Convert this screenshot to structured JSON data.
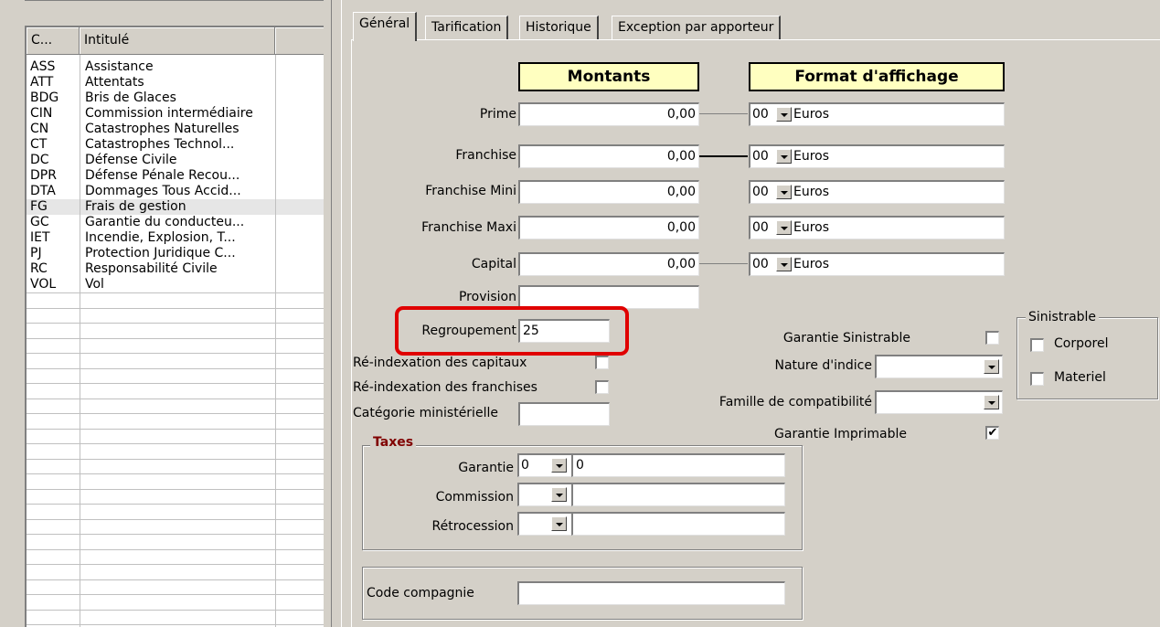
{
  "list": {
    "col_code": "C...",
    "col_label": "Intitulé",
    "rows": [
      {
        "code": "ASS",
        "label": "Assistance"
      },
      {
        "code": "ATT",
        "label": "Attentats"
      },
      {
        "code": "BDG",
        "label": "Bris de Glaces"
      },
      {
        "code": "CIN",
        "label": "Commission intermédiaire"
      },
      {
        "code": "CN",
        "label": "Catastrophes Naturelles"
      },
      {
        "code": "CT",
        "label": "Catastrophes Technol..."
      },
      {
        "code": "DC",
        "label": "Défense Civile"
      },
      {
        "code": "DPR",
        "label": "Défense Pénale Recou..."
      },
      {
        "code": "DTA",
        "label": "Dommages Tous Accid..."
      },
      {
        "code": "FG",
        "label": "Frais de gestion"
      },
      {
        "code": "GC",
        "label": "Garantie du conducteu..."
      },
      {
        "code": "IET",
        "label": "Incendie, Explosion, T..."
      },
      {
        "code": "PJ",
        "label": "Protection Juridique C..."
      },
      {
        "code": "RC",
        "label": "Responsabilité Civile"
      },
      {
        "code": "VOL",
        "label": "Vol"
      }
    ],
    "selected_code": "FG"
  },
  "tabs": [
    "Général",
    "Tarification",
    "Historique",
    "Exception par apporteur"
  ],
  "active_tab": "Général",
  "headers": {
    "amounts": "Montants",
    "display_format": "Format d'affichage"
  },
  "amounts": {
    "prime": {
      "label": "Prime",
      "value": "0,00",
      "format_code": "00",
      "unit": "Euros"
    },
    "franchise": {
      "label": "Franchise",
      "value": "0,00",
      "format_code": "00",
      "unit": "Euros"
    },
    "franchise_mini": {
      "label": "Franchise Mini",
      "value": "0,00",
      "format_code": "00",
      "unit": "Euros"
    },
    "franchise_maxi": {
      "label": "Franchise Maxi",
      "value": "0,00",
      "format_code": "00",
      "unit": "Euros"
    },
    "capital": {
      "label": "Capital",
      "value": "0,00",
      "format_code": "00",
      "unit": "Euros"
    },
    "provision": {
      "label": "Provision",
      "value": ""
    },
    "regroupement": {
      "label": "Regroupement",
      "value": "25"
    }
  },
  "options": {
    "reindex_capitaux": {
      "label": "Ré-indexation des capitaux",
      "checked": false
    },
    "reindex_franchises": {
      "label": "Ré-indexation des franchises",
      "checked": false
    },
    "categorie_ministerielle": {
      "label": "Catégorie ministérielle",
      "value": ""
    },
    "garantie_sinistrable": {
      "label": "Garantie Sinistrable",
      "checked": false
    },
    "nature_indice": {
      "label": "Nature d'indice",
      "value": ""
    },
    "famille_compat": {
      "label": "Famille de compatibilité",
      "value": ""
    },
    "garantie_imprimable": {
      "label": "Garantie Imprimable",
      "checked": true,
      "mark": "✔"
    }
  },
  "sinistrable": {
    "title": "Sinistrable",
    "corporel": "Corporel",
    "materiel": "Materiel"
  },
  "taxes": {
    "title": "Taxes",
    "garantie": {
      "label": "Garantie",
      "code": "0",
      "value": "0"
    },
    "commission": {
      "label": "Commission",
      "code": "",
      "value": ""
    },
    "retrocession": {
      "label": "Rétrocession",
      "code": "",
      "value": ""
    }
  },
  "code_compagnie": {
    "label": "Code compagnie",
    "value": ""
  },
  "colors": {
    "header_fill": "#ffffc0",
    "highlight": "#e00000",
    "group_title": "#800000"
  }
}
